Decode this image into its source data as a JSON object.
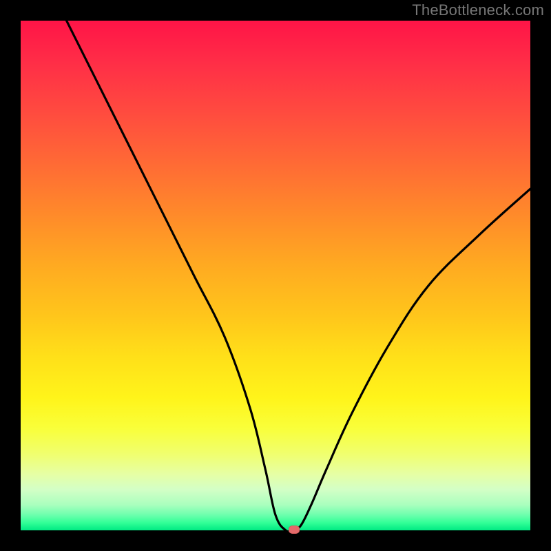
{
  "watermark": "TheBottleneck.com",
  "chart_data": {
    "type": "line",
    "title": "",
    "xlabel": "",
    "ylabel": "",
    "xlim": [
      0,
      100
    ],
    "ylim": [
      0,
      100
    ],
    "grid": false,
    "series": [
      {
        "name": "curve",
        "x": [
          9,
          15,
          22,
          28,
          34,
          40,
          45,
          48,
          50,
          52,
          53.5,
          55,
          57,
          60,
          65,
          72,
          80,
          90,
          100
        ],
        "y": [
          100,
          88,
          74,
          62,
          50,
          38,
          24,
          12,
          3,
          0,
          0,
          1,
          5,
          12,
          23,
          36,
          48,
          58,
          67
        ]
      }
    ],
    "indicator": {
      "x": 53.7,
      "y": 0.2
    },
    "colors": {
      "background_gradient_top": "#ff1447",
      "background_gradient_bottom": "#00ea83",
      "curve": "#000000",
      "indicator": "#e46a6a"
    }
  }
}
